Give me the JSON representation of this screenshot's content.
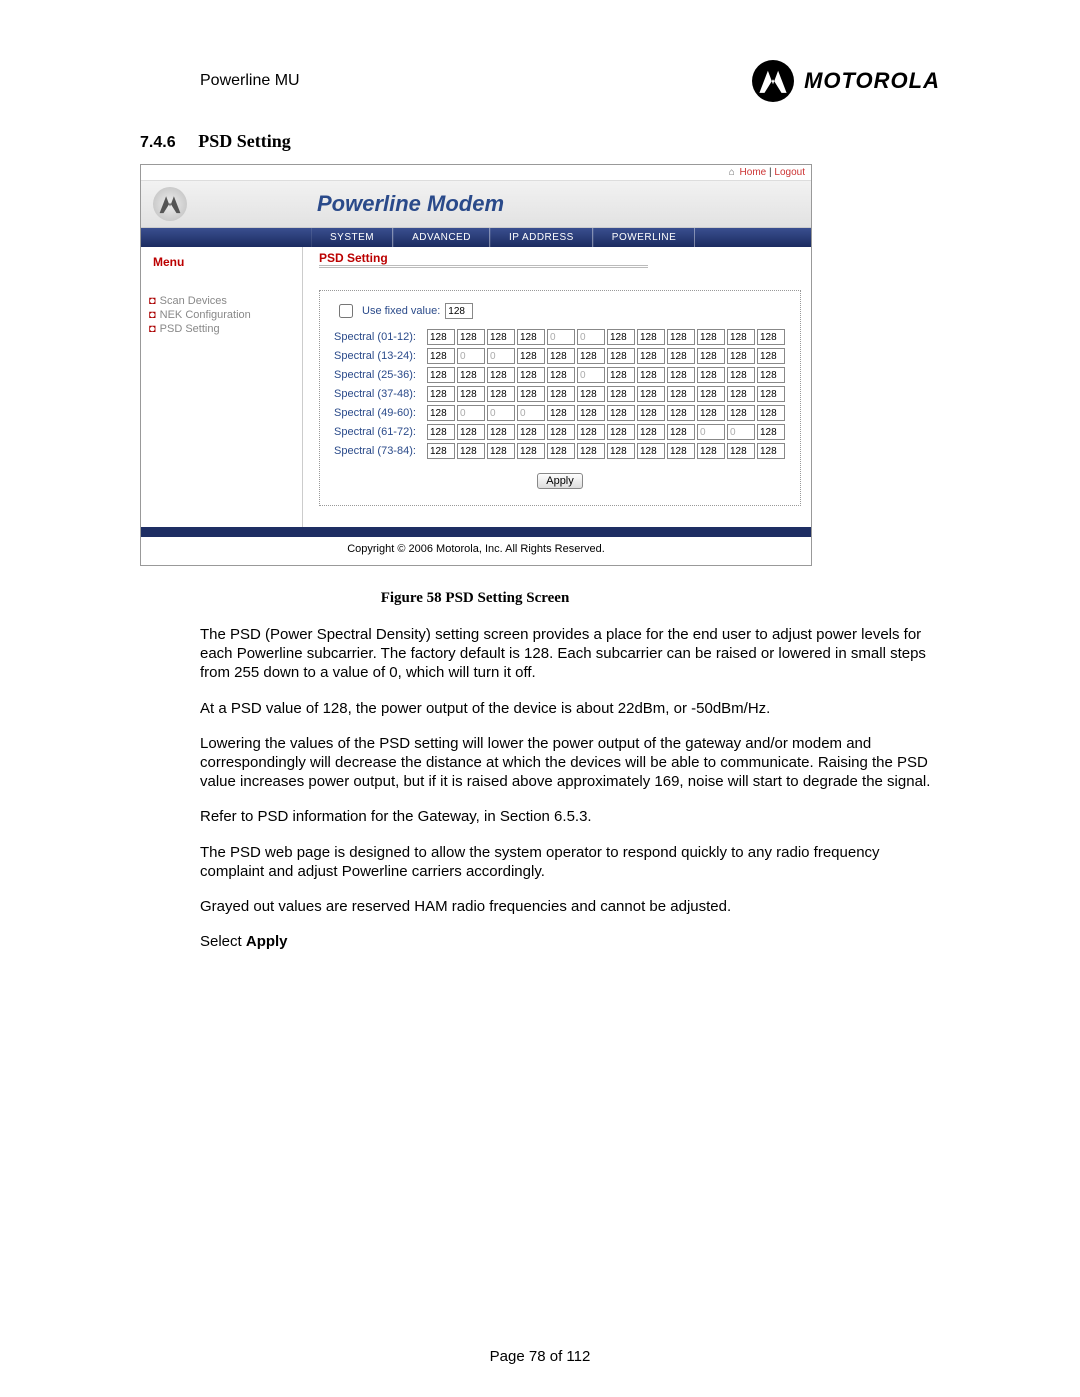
{
  "doc_header": "Powerline MU",
  "logo_word": "MOTOROLA",
  "section_number": "7.4.6",
  "section_title": "PSD Setting",
  "screenshot": {
    "top_links": {
      "home": "Home",
      "logout": "Logout"
    },
    "brand_title": "Powerline Modem",
    "tabs": [
      "SYSTEM",
      "ADVANCED",
      "IP ADDRESS",
      "POWERLINE"
    ],
    "sidebar": {
      "heading": "Menu",
      "items": [
        "Scan Devices",
        "NEK Configuration",
        "PSD Setting"
      ]
    },
    "panel_title": "PSD Setting",
    "use_fixed_label": "Use fixed value:",
    "use_fixed_value": "128",
    "spectral_rows": [
      {
        "label": "Spectral (01-12):",
        "cells": [
          {
            "v": "128"
          },
          {
            "v": "128"
          },
          {
            "v": "128"
          },
          {
            "v": "128"
          },
          {
            "v": "0",
            "dis": true
          },
          {
            "v": "0",
            "dis": true
          },
          {
            "v": "128"
          },
          {
            "v": "128"
          },
          {
            "v": "128"
          },
          {
            "v": "128"
          },
          {
            "v": "128"
          },
          {
            "v": "128"
          }
        ]
      },
      {
        "label": "Spectral (13-24):",
        "cells": [
          {
            "v": "128"
          },
          {
            "v": "0",
            "dis": true
          },
          {
            "v": "0",
            "dis": true
          },
          {
            "v": "128"
          },
          {
            "v": "128"
          },
          {
            "v": "128"
          },
          {
            "v": "128"
          },
          {
            "v": "128"
          },
          {
            "v": "128"
          },
          {
            "v": "128"
          },
          {
            "v": "128"
          },
          {
            "v": "128"
          }
        ]
      },
      {
        "label": "Spectral (25-36):",
        "cells": [
          {
            "v": "128"
          },
          {
            "v": "128"
          },
          {
            "v": "128"
          },
          {
            "v": "128"
          },
          {
            "v": "128"
          },
          {
            "v": "0",
            "dis": true
          },
          {
            "v": "128"
          },
          {
            "v": "128"
          },
          {
            "v": "128"
          },
          {
            "v": "128"
          },
          {
            "v": "128"
          },
          {
            "v": "128"
          }
        ]
      },
      {
        "label": "Spectral (37-48):",
        "cells": [
          {
            "v": "128"
          },
          {
            "v": "128"
          },
          {
            "v": "128"
          },
          {
            "v": "128"
          },
          {
            "v": "128"
          },
          {
            "v": "128"
          },
          {
            "v": "128"
          },
          {
            "v": "128"
          },
          {
            "v": "128"
          },
          {
            "v": "128"
          },
          {
            "v": "128"
          },
          {
            "v": "128"
          }
        ]
      },
      {
        "label": "Spectral (49-60):",
        "cells": [
          {
            "v": "128"
          },
          {
            "v": "0",
            "dis": true
          },
          {
            "v": "0",
            "dis": true
          },
          {
            "v": "0",
            "dis": true
          },
          {
            "v": "128"
          },
          {
            "v": "128"
          },
          {
            "v": "128"
          },
          {
            "v": "128"
          },
          {
            "v": "128"
          },
          {
            "v": "128"
          },
          {
            "v": "128"
          },
          {
            "v": "128"
          }
        ]
      },
      {
        "label": "Spectral (61-72):",
        "cells": [
          {
            "v": "128"
          },
          {
            "v": "128"
          },
          {
            "v": "128"
          },
          {
            "v": "128"
          },
          {
            "v": "128"
          },
          {
            "v": "128"
          },
          {
            "v": "128"
          },
          {
            "v": "128"
          },
          {
            "v": "128"
          },
          {
            "v": "0",
            "dis": true
          },
          {
            "v": "0",
            "dis": true
          },
          {
            "v": "128"
          }
        ]
      },
      {
        "label": "Spectral (73-84):",
        "cells": [
          {
            "v": "128"
          },
          {
            "v": "128"
          },
          {
            "v": "128"
          },
          {
            "v": "128"
          },
          {
            "v": "128"
          },
          {
            "v": "128"
          },
          {
            "v": "128"
          },
          {
            "v": "128"
          },
          {
            "v": "128"
          },
          {
            "v": "128"
          },
          {
            "v": "128"
          },
          {
            "v": "128"
          }
        ]
      }
    ],
    "apply_label": "Apply",
    "copyright": "Copyright   ©    2006  Motorola, Inc.  All Rights Reserved."
  },
  "figure_caption": "Figure 58 PSD Setting Screen",
  "paragraphs": [
    "The PSD (Power Spectral Density) setting screen provides a place for the end user to adjust power levels for each Powerline subcarrier. The factory default is 128. Each subcarrier can be raised or lowered in small steps from 255 down to a value of 0, which will turn it off.",
    "At a PSD value of 128, the power output of the device is about 22dBm, or -50dBm/Hz.",
    "Lowering the values of the PSD setting will lower the power output of the gateway and/or modem and correspondingly will decrease the distance at which the devices will be able to communicate. Raising the PSD value increases power output, but if it is raised above approximately 169, noise will start to degrade the signal.",
    "Refer to PSD information for the Gateway, in Section 6.5.3.",
    "The PSD web page is designed to allow the system operator to respond quickly to any radio frequency complaint and adjust Powerline carriers accordingly.",
    "Grayed out values are reserved HAM radio frequencies and cannot be adjusted."
  ],
  "select_apply_prefix": "Select ",
  "select_apply_bold": "Apply",
  "page_number": "Page 78 of 112"
}
